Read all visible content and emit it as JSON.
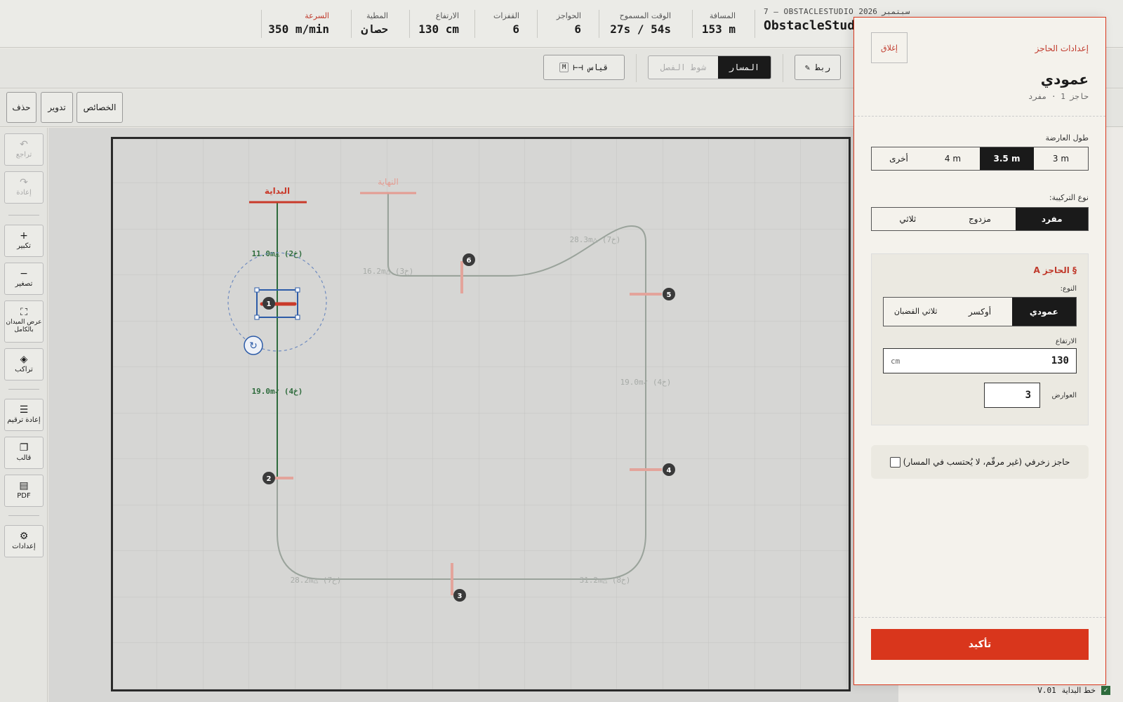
{
  "header": {
    "brand_sub": "7 — OBSTACLESTUDIO سبتمبر 2026",
    "brand_title": "ObstacleStudio",
    "stats": [
      {
        "label": "المسافة",
        "value": "153 m"
      },
      {
        "label": "الوقت المسموح",
        "value": "27s / 54s"
      },
      {
        "label": "الحواجز",
        "value": "6"
      },
      {
        "label": "القفزات",
        "value": "6"
      },
      {
        "label": "الارتفاع",
        "value": "130 cm"
      },
      {
        "label": "المطية",
        "value": "حصان"
      },
      {
        "label": "السرعة",
        "value": "350 m/min"
      }
    ]
  },
  "toolbar": {
    "mode_seg": [
      {
        "label": "المسار",
        "active": true
      },
      {
        "label": "شوط الفصل",
        "active": false
      }
    ],
    "link_label": "✎ ربط",
    "measure_label": "⊢⊣ قياس",
    "measure_key": "M"
  },
  "actions": {
    "delete": "حذف",
    "rotate": "تدوير",
    "properties": "الخصائص"
  },
  "rail": {
    "undo": "تراجع",
    "redo": "إعادة",
    "zoom_in": "تكبير",
    "zoom_out": "تصغير",
    "fit": "عرض الميدان بالكامل",
    "layers": "تراكب",
    "renumber": "إعادة ترقيم",
    "template": "قالب",
    "pdf": "PDF",
    "settings": "إعدادات"
  },
  "canvas": {
    "start_label": "البداية",
    "finish_label": "النهاية",
    "segment_labels": [
      "11.0m△ (2خ)",
      "19.0m✓ (4خ)",
      "16.2m△ (3خ)",
      "28.3m△ (7خ)",
      "19.0m✓ (4خ)",
      "28.2m△ (7خ)",
      "31.2m△ (8خ)"
    ],
    "obstacle_numbers": [
      "1",
      "2",
      "3",
      "4",
      "5",
      "6"
    ]
  },
  "right_panel": {
    "start_line_label": "خط البداية",
    "version": "V.01"
  },
  "modal": {
    "title_small": "إعدادات الحاجز",
    "close": "إغلاق",
    "title": "عمودي",
    "subtitle": "حاجز 1 · مفرد",
    "bar_length_label": "طول العارضة",
    "bar_length_options": [
      "3 m",
      "3.5 m",
      "4 m",
      "أخرى"
    ],
    "bar_length_selected": "3.5 m",
    "config_label": "نوع التركيبة:",
    "config_options": [
      "مفرد",
      "مزدوج",
      "ثلاثي"
    ],
    "config_selected": "مفرد",
    "sub_title": "§ الحاجز A",
    "type_label": "النوع:",
    "type_options": [
      "عمودي",
      "أوكسر",
      "ثلاثي القضبان"
    ],
    "type_selected": "عمودي",
    "height_label": "الارتفاع",
    "height_value": "130",
    "height_unit": "cm",
    "rails_label": "العوارض",
    "rails_value": "3",
    "decorative_label": "حاجز زخرفي (غير مرقّم، لا يُحتسب في المسار)",
    "confirm": "تأكيد"
  },
  "colors": {
    "accent": "#d9361c",
    "path_green": "#2e6b3c",
    "selection_blue": "#2d5ca8"
  }
}
